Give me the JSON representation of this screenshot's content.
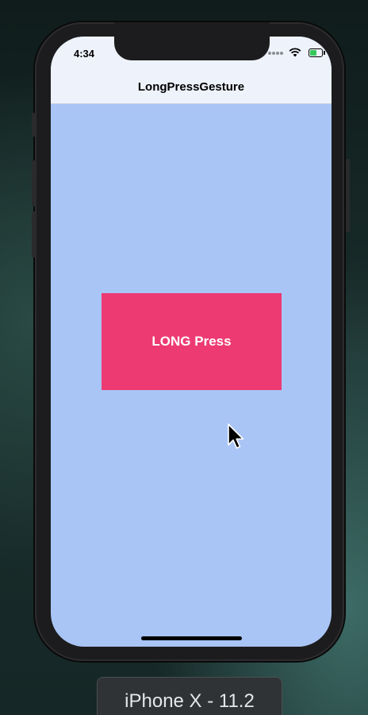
{
  "status_bar": {
    "time": "4:34",
    "battery_level": 0.6,
    "icons": [
      "cellular-signal-icon",
      "wifi-icon",
      "battery-charging-icon"
    ]
  },
  "nav": {
    "title": "LongPressGesture"
  },
  "main": {
    "button_label": "LONG Press"
  },
  "simulator": {
    "device_label": "iPhone X - 11.2"
  },
  "colors": {
    "background": "#a9c5f5",
    "button": "#ed3a73",
    "nav_bar": "#eef3fb"
  }
}
